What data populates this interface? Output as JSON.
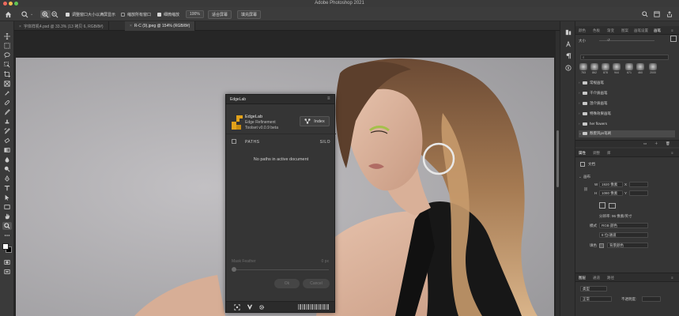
{
  "app": {
    "title": "Adobe Photoshop 2021"
  },
  "options_bar": {
    "resize_windows_label": "调整窗口大小以满屏显示",
    "resize_windows_checked": true,
    "zoom_all_label": "缩放所有窗口",
    "zoom_all_checked": false,
    "scrubby_zoom_label": "细微缩放",
    "scrubby_zoom_checked": true,
    "zoom_100_label": "100%",
    "fit_screen_label": "适合屏幕",
    "fill_screen_label": "填充屏幕"
  },
  "tabs": [
    {
      "label": "字体样机4.psd @ 33.3% (13 拷贝 6, RGB/8#)",
      "active": false
    },
    {
      "label": "R-C (9).jpeg @ 154% (RGB/8#)",
      "active": true
    }
  ],
  "edgelab": {
    "panel_name": "EdgeLab",
    "brand_title": "EdgeLab",
    "brand_subtitle": "Edge Refinement",
    "brand_version": "Toolset v0.0.9 beta",
    "index_label": "Index",
    "paths_header": "PATHS",
    "silo_header": "SILO",
    "empty_message": "No paths in active document",
    "mask_feather_label": "Mask Feather",
    "mask_feather_value": "0 px",
    "ok_label": "Ok",
    "cancel_label": "Cancel"
  },
  "right_panel": {
    "top_tabs": [
      "颜色",
      "色板",
      "渐变",
      "图案",
      "画笔设置",
      "画笔"
    ],
    "active_top_tab": "画笔",
    "size_label": "大小",
    "brush_sizes": [
      "753",
      "862",
      "878",
      "944",
      "671",
      "460",
      "2000"
    ],
    "folders": [
      {
        "label": "常规画笔",
        "selected": false
      },
      {
        "label": "干介质画笔",
        "selected": false
      },
      {
        "label": "湿介质画笔",
        "selected": false
      },
      {
        "label": "特殊效果画笔",
        "selected": false
      },
      {
        "label": "her flowers",
        "selected": false
      },
      {
        "label": "颓废风ps笔刷",
        "selected": true
      }
    ],
    "props_tabs": [
      "属性",
      "调整",
      "库"
    ],
    "active_props_tab": "属性",
    "doc_label": "文档",
    "canvas_section": "画布",
    "w_label": "W",
    "w_value": "1920 像素",
    "x_label": "X",
    "h_label": "H",
    "h_value": "1080 像素",
    "y_label": "Y",
    "resolution": "分辨率: 96 像素/英寸",
    "mode_label": "模式",
    "mode_value": "RGB 颜色",
    "depth_value": "8 位/通道",
    "fill_label": "填色",
    "fill_value": "背景颜色",
    "layers_tabs": [
      "图层",
      "通道",
      "路径"
    ],
    "active_layers_tab": "图层",
    "layer_kind": "类型",
    "blend_mode": "正常",
    "opacity_label": "不透明度:"
  },
  "colors": {
    "accent_yellow": "#e2a21b",
    "panel_bg": "#353535",
    "ps_bg": "#262626"
  }
}
